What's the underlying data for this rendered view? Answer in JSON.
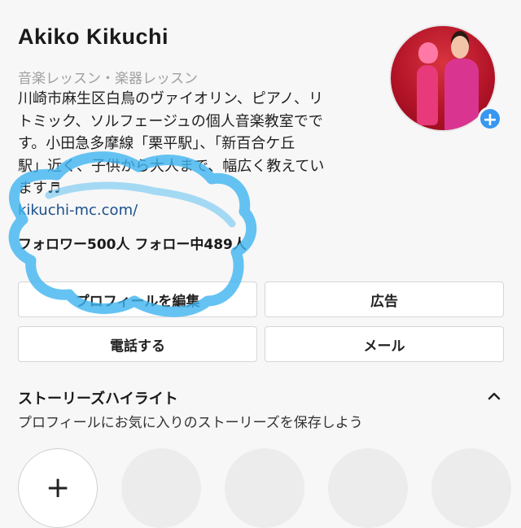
{
  "profile": {
    "name": "Akiko  Kikuchi",
    "category": "音楽レッスン・楽器レッスン",
    "bio_lines": [
      "川崎市麻生区白鳥のヴァイオリン、ピアノ、リ",
      "トミック、ソルフェージュの個人音楽教室でで",
      "す。小田急多摩線「栗平駅」、「新百合ケ丘",
      "駅」近く、子供から大人まで、幅広く教えてい",
      "ます♬"
    ],
    "link": "kikuchi-mc.com/",
    "stats": "フォロワー500人  フォロー中489人",
    "avatar_badge": "+"
  },
  "buttons": {
    "edit_profile": "プロフィールを編集",
    "ads": "広告",
    "call": "電話する",
    "email": "メール"
  },
  "highlights": {
    "title": "ストーリーズハイライト",
    "subtitle": "プロフィールにお気に入りのストーリーズを保存しよう",
    "new_label": "+"
  },
  "colors": {
    "scribble": "#3fb4f0",
    "badge": "#3897f0",
    "link": "#1a4f8c"
  }
}
